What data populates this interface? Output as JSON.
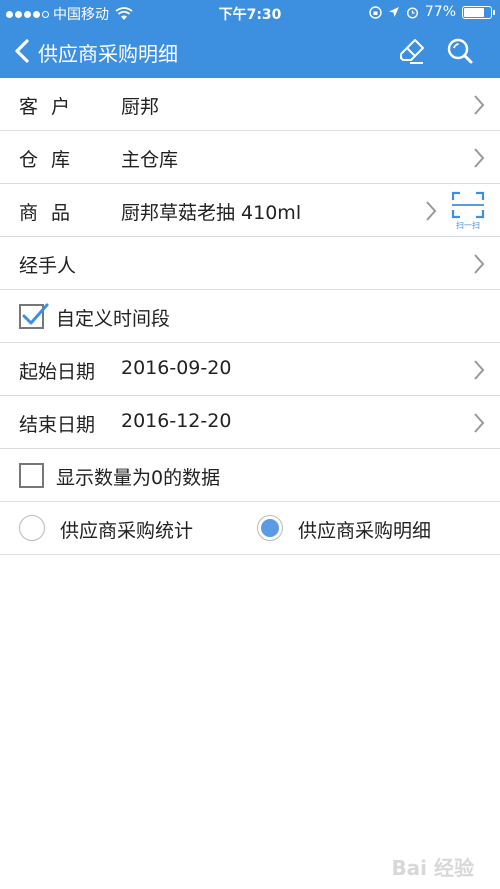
{
  "status": {
    "carrier": "中国移动",
    "time": "下午7:30",
    "battery": "77%",
    "battery_level": 0.77
  },
  "nav": {
    "title": "供应商采购明细",
    "back_icon": "chevron-left-icon",
    "eraser_icon": "eraser-icon",
    "search_icon": "search-icon"
  },
  "form": {
    "customer": {
      "label": "客户",
      "value": "厨邦"
    },
    "warehouse": {
      "label": "仓库",
      "value": "主仓库"
    },
    "product": {
      "label": "商品",
      "value": "厨邦草菇老抽 410ml",
      "scan_label": "扫一扫"
    },
    "handler": {
      "label": "经手人",
      "value": ""
    },
    "custom_period": {
      "label": "自定义时间段",
      "checked": true
    },
    "start_date": {
      "label": "起始日期",
      "value": "2016-09-20"
    },
    "end_date": {
      "label": "结束日期",
      "value": "2016-12-20"
    },
    "show_zero": {
      "label": "显示数量为0的数据",
      "checked": false
    },
    "report_type": {
      "options": [
        "供应商采购统计",
        "供应商采购明细"
      ],
      "selected": "供应商采购明细"
    }
  },
  "colors": {
    "accent": "#3d8fe0",
    "radio_selected": "#5a9ae6"
  },
  "watermark": "Bai 经验"
}
